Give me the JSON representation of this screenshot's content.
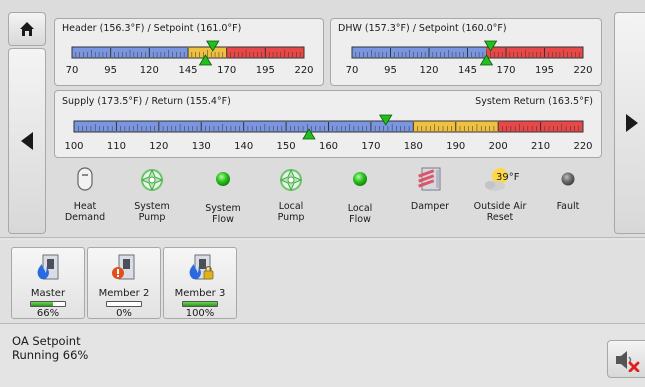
{
  "nav": {
    "home_icon": "home-icon",
    "left_icon": "triangle-left-icon",
    "right_icon": "triangle-right-icon"
  },
  "gauges": {
    "header": {
      "title": "Header (156.3°F) / Setpoint (161.0°F)",
      "labels": [
        "70",
        "95",
        "120",
        "145",
        "170",
        "195",
        "220"
      ],
      "min": 70,
      "max": 220,
      "actual": 156.3,
      "setpoint": 161.0,
      "zones": [
        {
          "from": 70,
          "to": 145,
          "color": "#7b96e0"
        },
        {
          "from": 145,
          "to": 170,
          "color": "#f0c040"
        },
        {
          "from": 170,
          "to": 220,
          "color": "#e84848"
        }
      ]
    },
    "dhw": {
      "title": "DHW (157.3°F) / Setpoint (160.0°F)",
      "labels": [
        "70",
        "95",
        "120",
        "145",
        "170",
        "195",
        "220"
      ],
      "min": 70,
      "max": 220,
      "actual": 157.3,
      "setpoint": 160.0,
      "zones": [
        {
          "from": 70,
          "to": 157,
          "color": "#7b96e0"
        },
        {
          "from": 157,
          "to": 220,
          "color": "#e84848"
        }
      ]
    },
    "supply": {
      "title": "Supply (173.5°F) / Return (155.4°F)",
      "title_right": "System Return (163.5°F)",
      "labels": [
        "100",
        "110",
        "120",
        "130",
        "140",
        "150",
        "160",
        "170",
        "180",
        "190",
        "200",
        "210",
        "220"
      ],
      "min": 100,
      "max": 220,
      "actual": 155.4,
      "setpoint": 173.5,
      "zones": [
        {
          "from": 100,
          "to": 180,
          "color": "#7b96e0"
        },
        {
          "from": 180,
          "to": 200,
          "color": "#f0c040"
        },
        {
          "from": 200,
          "to": 220,
          "color": "#e84848"
        }
      ]
    }
  },
  "status_items": [
    {
      "line1": "Heat",
      "line2": "Demand",
      "icon": "thermostat-icon"
    },
    {
      "line1": "System",
      "line2": "Pump",
      "icon": "pump-icon"
    },
    {
      "line1": "System",
      "line2": "Flow",
      "icon": "green-led-icon"
    },
    {
      "line1": "Local",
      "line2": "Pump",
      "icon": "pump-icon"
    },
    {
      "line1": "Local",
      "line2": "Flow",
      "icon": "green-led-icon"
    },
    {
      "line1": "Damper",
      "line2": "",
      "icon": "damper-icon"
    },
    {
      "line1": "Outside Air",
      "line2": "Reset",
      "icon": "sun-cloud-icon",
      "value": "39°F"
    },
    {
      "line1": "Fault",
      "line2": "",
      "icon": "grey-led-icon"
    }
  ],
  "boilers": [
    {
      "name": "Master",
      "percent": "66%",
      "level": 0.66,
      "icon": "boiler-flame-icon"
    },
    {
      "name": "Member 2",
      "percent": "0%",
      "level": 0.0,
      "icon": "boiler-alert-icon"
    },
    {
      "name": "Member 3",
      "percent": "100%",
      "level": 1.0,
      "icon": "boiler-flame-lock-icon"
    }
  ],
  "status": {
    "line1": "OA Setpoint",
    "line2": "Running 66%"
  },
  "mute_icon": "speaker-muted-icon",
  "colors": {
    "blue": "#7b96e0",
    "yellow": "#f0c040",
    "red": "#e84848",
    "green": "#22a81c"
  }
}
